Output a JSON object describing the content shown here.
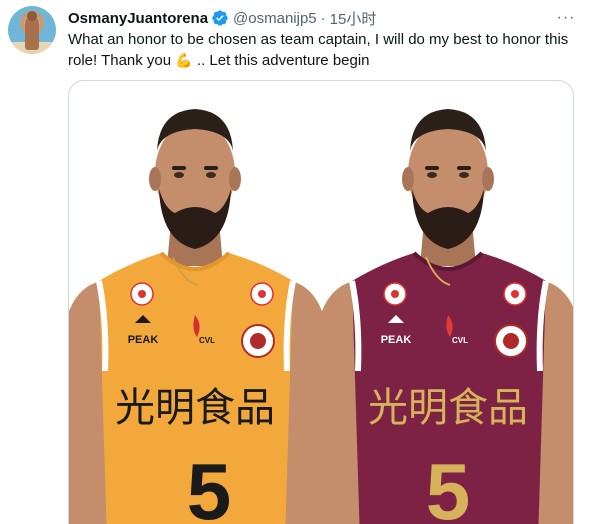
{
  "tweet": {
    "author_name": "OsmanyJuantorena",
    "author_handle": "@osmanijp5",
    "separator": "·",
    "time": "15小时",
    "text_part1": "What an honor to be chosen as team captain, I will do my best to honor this role! Thank you ",
    "emoji": "💪",
    "text_part2": " .. Let this adventure begin",
    "more_label": "···"
  },
  "media": {
    "jerseys": [
      {
        "color": "#f2a83b",
        "trim": "#ffffff",
        "accent": "#1a1a1a",
        "chinese_text": "光明食品",
        "number": "5",
        "brand": "PEAK",
        "league": "CVL"
      },
      {
        "color": "#7d2245",
        "trim": "#ffffff",
        "accent": "#d6b25a",
        "chinese_text": "光明食品",
        "number": "5",
        "brand": "PEAK",
        "league": "CVL"
      }
    ]
  },
  "colors": {
    "verified": "#1d9bf0",
    "secondary_text": "#536471",
    "border": "#cfd9de"
  },
  "icons": {
    "verified": "verified-badge-icon",
    "more": "more-dots-icon"
  }
}
